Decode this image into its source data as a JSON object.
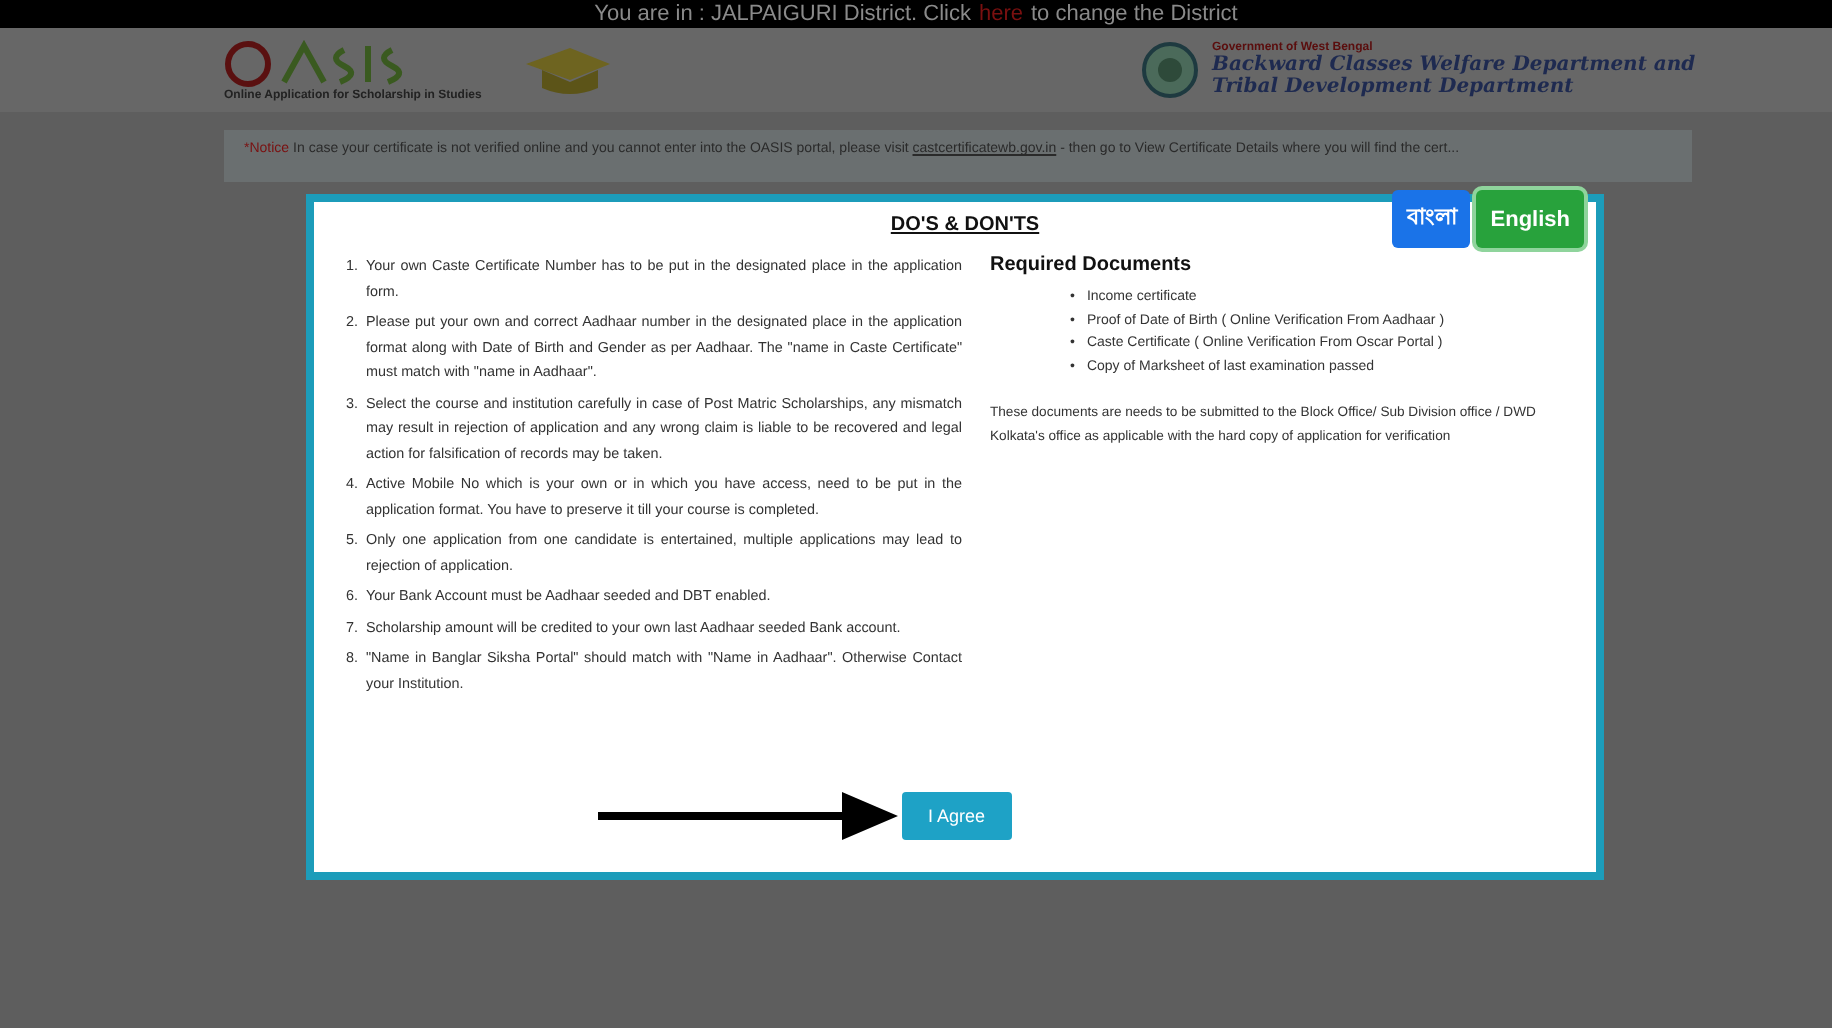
{
  "top_bar": {
    "prefix": "You are in : JALPAIGURI District. Click",
    "link": "here",
    "suffix": "to change the District"
  },
  "header": {
    "logo_tagline": "Online Application for Scholarship in Studies",
    "department_gov": "Government of West Bengal",
    "department_name": "Backward Classes Welfare Department and Tribal Development Department"
  },
  "notice": {
    "label": "*Notice",
    "text": "In case your certificate is not verified online and you cannot enter into the OASIS portal, please visit",
    "link": "castcertificatewb.gov.in",
    "rest": "- then go to View Certificate Details where you will find the cert..."
  },
  "modal": {
    "title": "DO'S & DON'TS",
    "languages": [
      {
        "label": "বাংলা",
        "selected": false,
        "color": "#1a73e8"
      },
      {
        "label": "English",
        "selected": true,
        "color": "#28a23c"
      }
    ],
    "rule_markers": [
      "1.",
      "2.",
      "3.",
      "4.",
      "5.",
      "6.",
      "7.",
      "8."
    ],
    "bullet": "•",
    "rules": [
      "Your own Caste Certificate Number has to be put in the designated place in the application form.",
      "Please put your own and correct Aadhaar number in the designated place in the application format along with Date of Birth and Gender as per Aadhaar. The \"name in Caste Certificate\" must match with \"name in Aadhaar\".",
      "Select the course and institution carefully in case of Post Matric Scholarships, any mismatch may result in rejection of application and any wrong claim is liable to be recovered and legal action for falsification of records may be taken.",
      "Active Mobile No which is your own or in which you have access, need to be put in the application format. You have to preserve it till your course is completed.",
      "Only one application from one candidate is entertained, multiple applications may lead to rejection of application.",
      "Your Bank Account must be Aadhaar seeded and DBT enabled.",
      "Scholarship amount will be credited to your own last Aadhaar seeded Bank account.",
      "\"Name in Banglar Siksha Portal\" should match with \"Name in Aadhaar\". Otherwise Contact your Institution."
    ],
    "documents_title": "Required Documents",
    "documents": [
      "Income certificate",
      "Proof of Date of Birth ( Online Verification From Aadhaar )",
      "Caste Certificate ( Online Verification From Oscar Portal )",
      "Copy of Marksheet of last examination passed"
    ],
    "documents_note": "These documents are needs to be submitted to the Block Office/ Sub Division office / DWD Kolkata's office as applicable with the hard copy of application for verification",
    "agree_button": "I Agree"
  }
}
